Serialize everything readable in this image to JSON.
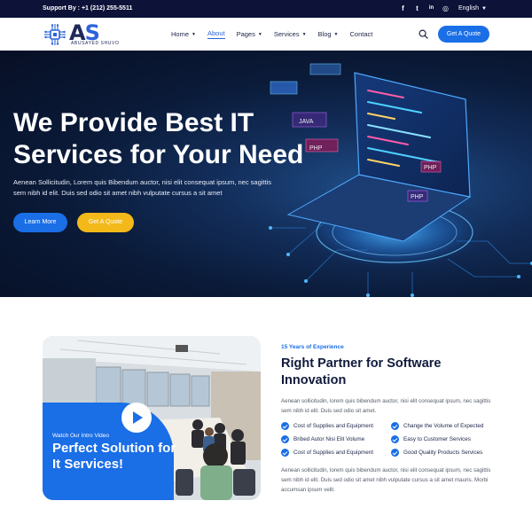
{
  "topbar": {
    "support": "Support By : +1 (212) 255-5511",
    "socials": [
      {
        "icon": "facebook-icon",
        "glyph": "f"
      },
      {
        "icon": "twitter-icon",
        "glyph": "t"
      },
      {
        "icon": "linkedin-icon",
        "glyph": "in"
      },
      {
        "icon": "instagram-icon",
        "glyph": "◎"
      }
    ],
    "language": "English"
  },
  "header": {
    "logo_text": "AS",
    "logo_sub": "ABUSAYED SHUVO",
    "nav": [
      {
        "label": "Home",
        "dropdown": true,
        "active": false
      },
      {
        "label": "About",
        "dropdown": false,
        "active": true
      },
      {
        "label": "Pages",
        "dropdown": true,
        "active": false
      },
      {
        "label": "Services",
        "dropdown": true,
        "active": false
      },
      {
        "label": "Blog",
        "dropdown": true,
        "active": false
      },
      {
        "label": "Contact",
        "dropdown": false,
        "active": false
      }
    ],
    "quote_button": "Get A Quote"
  },
  "hero": {
    "title": "We Provide Best IT Services for Your Need",
    "subtitle": "Aenean Sollicitudin, Lorem quis Bibendum auctor, nisi elit consequat ipsum, nec sagittis sem nibh id elit. Duis sed odio sit amet nibh vulputate cursus a sit amet",
    "learn_more": "Learn More",
    "get_quote": "Get A Quote",
    "screen_labels": [
      "PHP",
      "JAVA",
      "PHP",
      "PHP"
    ]
  },
  "about": {
    "video_label": "Watch Our Intro Video",
    "video_title": "Perfect Solution for It Services!",
    "eyebrow": "15 Years of Experience",
    "title": "Right Partner for Software Innovation",
    "paragraph1": "Aenean sollicitudin, lorem quis bibendum auctor, nisi elit consequat ipsum, nec sagittis sem nibh id elit. Duis sed odio sit amet.",
    "features": [
      "Cost of Supplies and Equipment",
      "Change the Volume of Expected",
      "Bribed Autor Nisi Elit Volume",
      "Easy to Customer Services",
      "Cost of Supplies and Equipment",
      "Good Quality Products Services"
    ],
    "paragraph2": "Aenean sollicitudin, lorem quis bibendum auctor, nisi elit consequat ipsum, nec sagittis sem nibh id elit. Duis sed odio sit amet nibh vulputate cursus a sit amet mauris. Morbi accumsan ipsum velit."
  },
  "colors": {
    "primary": "#1a6ee6",
    "accent": "#f3b91a",
    "dark": "#0c1238"
  }
}
